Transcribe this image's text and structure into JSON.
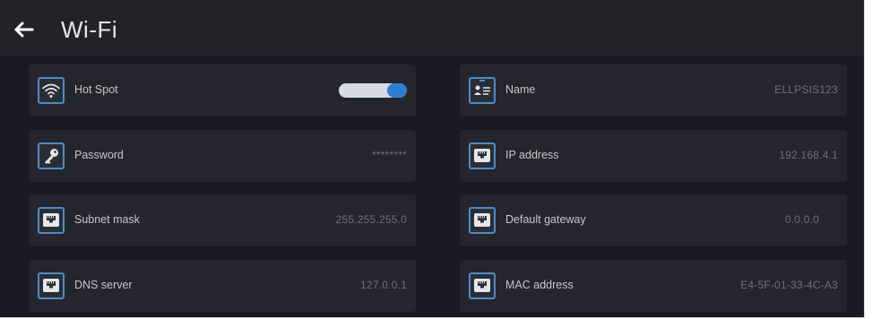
{
  "header": {
    "title": "Wi-Fi",
    "back_icon": "arrow-left-icon"
  },
  "settings": [
    {
      "label": "Hot Spot",
      "icon": "wifi-icon",
      "control": "toggle",
      "toggle_on": true
    },
    {
      "label": "Name",
      "icon": "contact-card-icon",
      "value": "ELLPSIS123"
    },
    {
      "label": "Password",
      "icon": "key-icon",
      "value": "********"
    },
    {
      "label": "IP address",
      "icon": "ethernet-port-icon",
      "value": "192.168.4.1"
    },
    {
      "label": "Subnet mask",
      "icon": "ethernet-port-icon",
      "value": "255.255.255.0"
    },
    {
      "label": "Default gateway",
      "icon": "ethernet-port-icon",
      "value": "0.0.0.0"
    },
    {
      "label": "DNS server",
      "icon": "ethernet-port-icon",
      "value": "127.0.0.1"
    },
    {
      "label": "MAC address",
      "icon": "ethernet-port-icon",
      "value": "E4-5F-01-33-4C-A3"
    }
  ],
  "colors": {
    "background": "#1a1b22",
    "tile": "#25262d",
    "accent": "#2f7fd0",
    "icon_border": "#4b8cc7"
  }
}
